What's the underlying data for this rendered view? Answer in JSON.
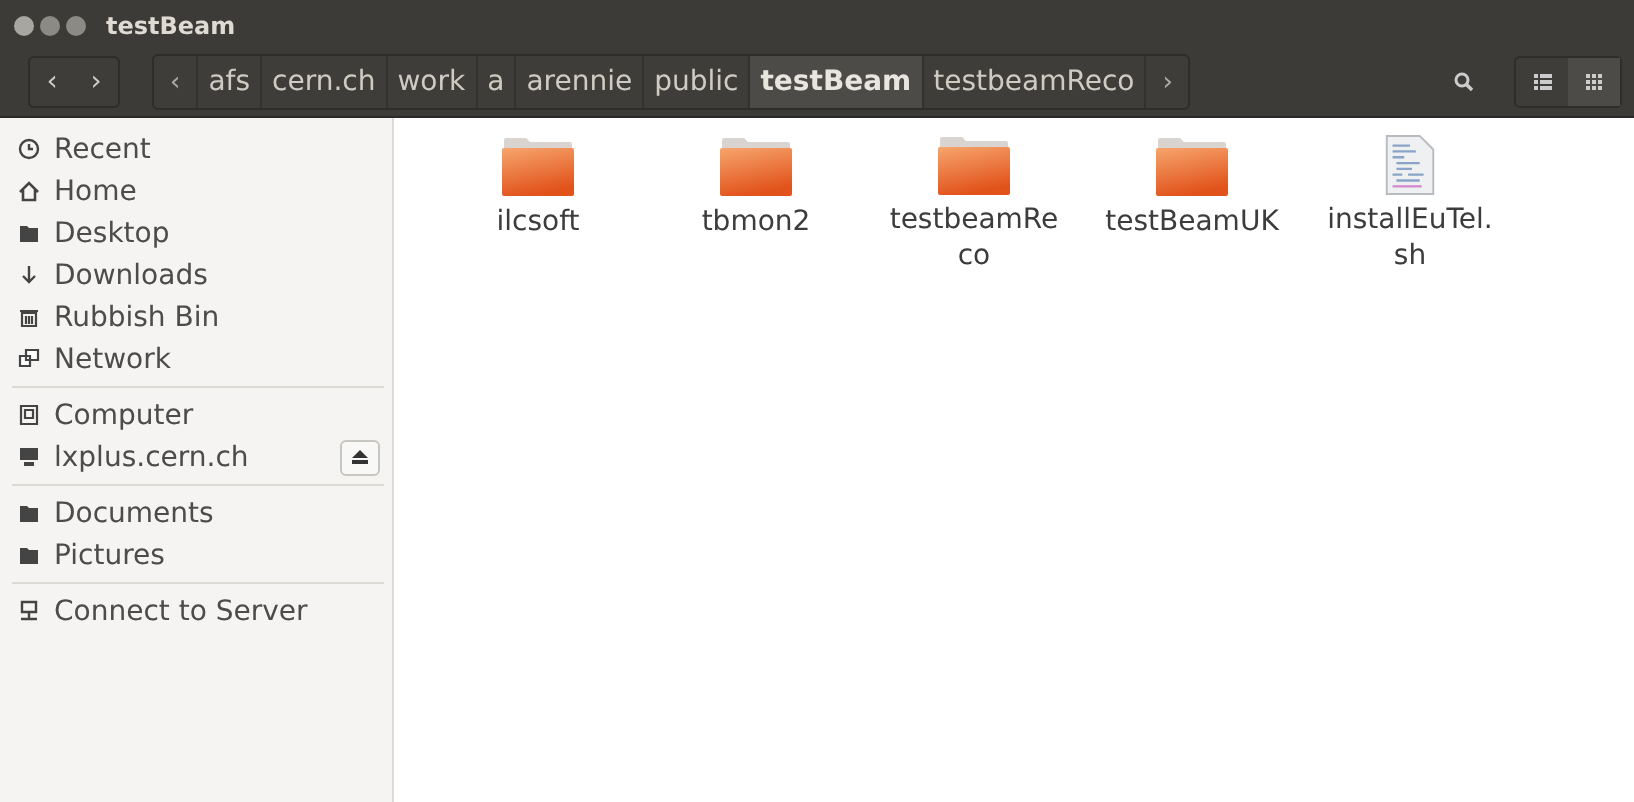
{
  "window": {
    "title": "testBeam"
  },
  "nav": {
    "back": "‹",
    "forward": "›"
  },
  "path": {
    "scroll_left": "‹",
    "scroll_right": "›",
    "segments": [
      {
        "label": "afs",
        "selected": false
      },
      {
        "label": "cern.ch",
        "selected": false
      },
      {
        "label": "work",
        "selected": false
      },
      {
        "label": "a",
        "selected": false
      },
      {
        "label": "arennie",
        "selected": false
      },
      {
        "label": "public",
        "selected": false
      },
      {
        "label": "testBeam",
        "selected": true
      },
      {
        "label": "testbeamReco",
        "selected": false
      }
    ]
  },
  "view_buttons": [
    {
      "kind": "list",
      "selected": false
    },
    {
      "kind": "grid",
      "selected": true
    }
  ],
  "sidebar": {
    "groups": [
      [
        {
          "label": "Recent",
          "kind": "clock"
        },
        {
          "label": "Home",
          "kind": "home"
        },
        {
          "label": "Desktop",
          "kind": "folder"
        },
        {
          "label": "Downloads",
          "kind": "download"
        },
        {
          "label": "Rubbish Bin",
          "kind": "trash"
        },
        {
          "label": "Network",
          "kind": "network"
        }
      ],
      [
        {
          "label": "Computer",
          "kind": "drive"
        },
        {
          "label": "lxplus.cern.ch",
          "kind": "server",
          "eject": true
        }
      ],
      [
        {
          "label": "Documents",
          "kind": "folder"
        },
        {
          "label": "Pictures",
          "kind": "folder"
        }
      ],
      [
        {
          "label": "Connect to Server",
          "kind": "connect"
        }
      ]
    ]
  },
  "files": [
    {
      "name": "ilcsoft",
      "kind": "folder"
    },
    {
      "name": "tbmon2",
      "kind": "folder"
    },
    {
      "name": "testbeamReco",
      "kind": "folder"
    },
    {
      "name": "testBeamUK",
      "kind": "folder"
    },
    {
      "name": "installEuTel.sh",
      "kind": "script"
    }
  ]
}
